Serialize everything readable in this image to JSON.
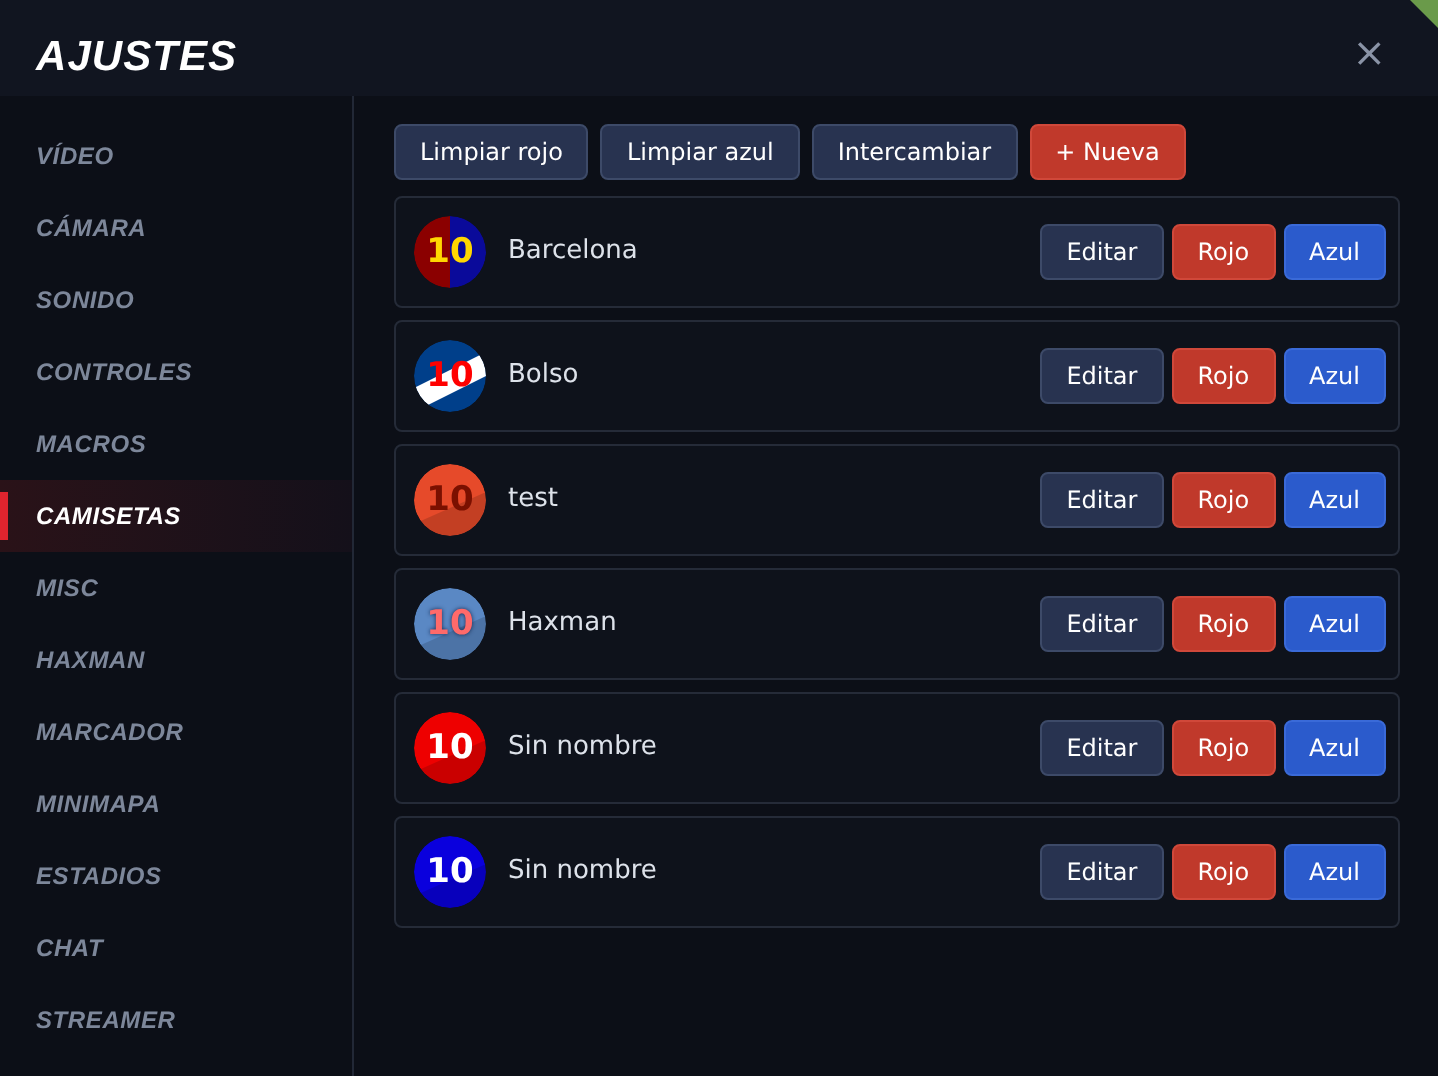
{
  "title": "AJUSTES",
  "close": "×",
  "sidebar": [
    {
      "label": "VÍDEO",
      "selected": false
    },
    {
      "label": "CÁMARA",
      "selected": false
    },
    {
      "label": "SONIDO",
      "selected": false
    },
    {
      "label": "CONTROLES",
      "selected": false
    },
    {
      "label": "MACROS",
      "selected": false
    },
    {
      "label": "CAMISETAS",
      "selected": true
    },
    {
      "label": "MISC",
      "selected": false
    },
    {
      "label": "HAXMAN",
      "selected": false
    },
    {
      "label": "MARCADOR",
      "selected": false
    },
    {
      "label": "MINIMAPA",
      "selected": false
    },
    {
      "label": "ESTADIOS",
      "selected": false
    },
    {
      "label": "CHAT",
      "selected": false
    },
    {
      "label": "STREAMER",
      "selected": false
    }
  ],
  "toolbar": [
    {
      "label": "Limpiar rojo",
      "kind": "neutral"
    },
    {
      "label": "Limpiar azul",
      "kind": "neutral"
    },
    {
      "label": "Intercambiar",
      "kind": "neutral"
    },
    {
      "label": "+ Nueva",
      "kind": "red"
    }
  ],
  "jerseys": [
    {
      "name": "Barcelona",
      "number": "10",
      "kind": "split",
      "color": "#8b0000",
      "actions": [
        {
          "label": "Editar",
          "kind": "neutral"
        },
        {
          "label": "Rojo",
          "kind": "red"
        },
        {
          "label": "Azul",
          "kind": "blue"
        }
      ]
    },
    {
      "name": "Bolso",
      "number": "10",
      "kind": "sash",
      "color": "#003f8a",
      "actions": [
        {
          "label": "Editar",
          "kind": "neutral"
        },
        {
          "label": "Rojo",
          "kind": "red"
        },
        {
          "label": "Azul",
          "kind": "blue"
        }
      ]
    },
    {
      "name": "test",
      "number": "10",
      "kind": "shaded-dark",
      "color": "#e64a2a",
      "actions": [
        {
          "label": "Editar",
          "kind": "neutral"
        },
        {
          "label": "Rojo",
          "kind": "red"
        },
        {
          "label": "Azul",
          "kind": "blue"
        }
      ]
    },
    {
      "name": "Haxman",
      "number": "10",
      "kind": "shaded-coral",
      "color": "#5a88c4",
      "actions": [
        {
          "label": "Editar",
          "kind": "neutral"
        },
        {
          "label": "Rojo",
          "kind": "red"
        },
        {
          "label": "Azul",
          "kind": "blue"
        }
      ]
    },
    {
      "name": "Sin nombre",
      "number": "10",
      "kind": "shaded",
      "color": "#ee0000",
      "actions": [
        {
          "label": "Editar",
          "kind": "neutral"
        },
        {
          "label": "Rojo",
          "kind": "red"
        },
        {
          "label": "Azul",
          "kind": "blue"
        }
      ]
    },
    {
      "name": "Sin nombre",
      "number": "10",
      "kind": "shaded",
      "color": "#0a00dd",
      "actions": [
        {
          "label": "Editar",
          "kind": "neutral"
        },
        {
          "label": "Rojo",
          "kind": "red"
        },
        {
          "label": "Azul",
          "kind": "blue"
        }
      ]
    }
  ]
}
